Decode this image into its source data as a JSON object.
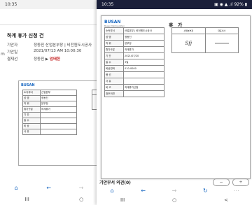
{
  "back": {
    "status_time": "10:35",
    "approve_label": "결재",
    "side_mark": "m",
    "title": "하계 휴가 신청 건",
    "meta": [
      {
        "k": "기안자",
        "v": "정동진 산업본부장 | 비전원도시공사"
      },
      {
        "k": "기안일",
        "v": "2021/07/13 AM 10:00:30"
      },
      {
        "k": "결재선",
        "v": "정동진 ▶ ",
        "highlight": "엄태한"
      }
    ],
    "form_title": "휴 가",
    "form_rows": [
      {
        "label": "소속부서",
        "value": "산업본부"
      },
      {
        "label": "성 명",
        "value": "정동진"
      },
      {
        "label": "직 위",
        "value": "본부장"
      },
      {
        "label": "휴가구분",
        "value": "하계휴가"
      },
      {
        "label": "기 간",
        "value": ""
      },
      {
        "label": "일 수",
        "value": ""
      },
      {
        "label": "비 상",
        "value": ""
      },
      {
        "label": "사 유",
        "value": ""
      }
    ]
  },
  "front": {
    "status_time": "10:35",
    "status_icons": "▣ ◉ ▲ .ıl 92% ▮",
    "form_title": "휴 가",
    "logo": "BUSAN",
    "logo_sub": "Busan Metropolitan",
    "form_rows": [
      {
        "label": "소속부서",
        "value": "산업본부 | 비전원도시공사"
      },
      {
        "label": "성 명",
        "value": "정동진"
      },
      {
        "label": "직 위",
        "value": "본부장"
      },
      {
        "label": "휴가구분",
        "value": "하계휴가"
      },
      {
        "label": "기 간",
        "value": "2021/07/20"
      },
      {
        "label": "일 수",
        "value": "3일"
      },
      {
        "label": "비상연락",
        "value": "010-0000"
      },
      {
        "label": "행 선",
        "value": ""
      },
      {
        "label": "사 유",
        "value": ""
      },
      {
        "label": "비 고",
        "value": "하계휴가신청"
      },
      {
        "label": "참조의견",
        "value": ""
      }
    ],
    "sign_headers": [
      "산업본부장",
      "대표이사"
    ],
    "signature": "Sfj",
    "opinion_label": "기안부서 의견(0)",
    "zoom_out": "−",
    "zoom_in": "+"
  },
  "nav": {
    "home": "⌂",
    "back": "←",
    "forward": "→",
    "reload": "↻",
    "more": "⋯"
  },
  "sys": {
    "recents": "III",
    "home": "○",
    "back": "<"
  }
}
